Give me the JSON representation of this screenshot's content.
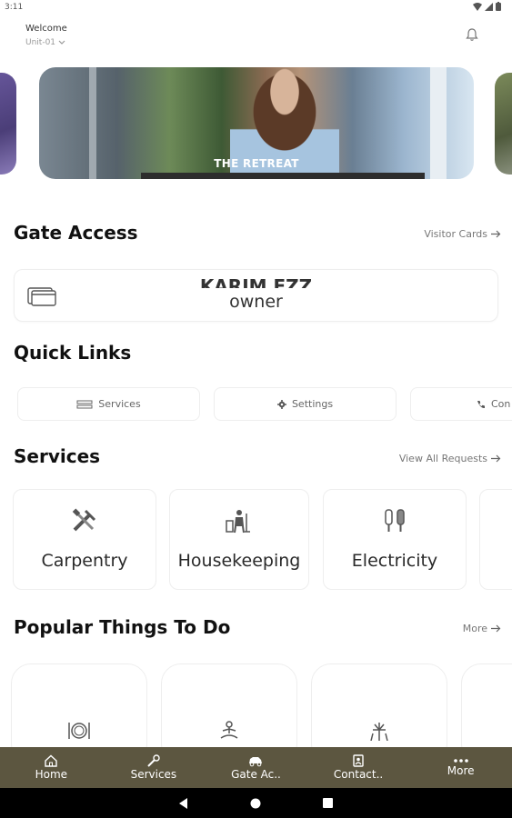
{
  "status_bar": {
    "time": "3:11"
  },
  "header": {
    "welcome": "Welcome",
    "unit": "Unit-01"
  },
  "carousel": {
    "slides": [
      {
        "caption": "THE RETREAT"
      }
    ]
  },
  "gate_access": {
    "title": "Gate Access",
    "link_label": "Visitor Cards",
    "card": {
      "name": "KARIM EZZ",
      "role": "owner"
    }
  },
  "quick_links": {
    "title": "Quick Links",
    "items": [
      {
        "label": "Services",
        "icon": "services-icon"
      },
      {
        "label": "Settings",
        "icon": "gear-icon"
      },
      {
        "label": "Con",
        "icon": "phone-icon"
      }
    ]
  },
  "services": {
    "title": "Services",
    "link_label": "View All Requests",
    "items": [
      {
        "label": "Carpentry",
        "icon": "carpentry-tools-icon"
      },
      {
        "label": "Housekeeping",
        "icon": "housekeeping-icon"
      },
      {
        "label": "Electricity",
        "icon": "electricity-icon"
      }
    ]
  },
  "popular": {
    "title": "Popular Things To Do",
    "link_label": "More",
    "items": [
      {
        "icon": "dining-icon"
      },
      {
        "icon": "yoga-icon"
      },
      {
        "icon": "fireworks-icon"
      }
    ]
  },
  "bottom_nav": {
    "items": [
      {
        "label": "Home",
        "icon": "home-icon"
      },
      {
        "label": "Services",
        "icon": "wrench-icon"
      },
      {
        "label": "Gate Ac..",
        "icon": "car-icon"
      },
      {
        "label": "Contact..",
        "icon": "contact-book-icon"
      },
      {
        "label": "More",
        "icon": "more-dots-icon"
      }
    ]
  },
  "colors": {
    "nav_bg": "#5c5640",
    "text": "#111111",
    "muted": "#777777"
  }
}
